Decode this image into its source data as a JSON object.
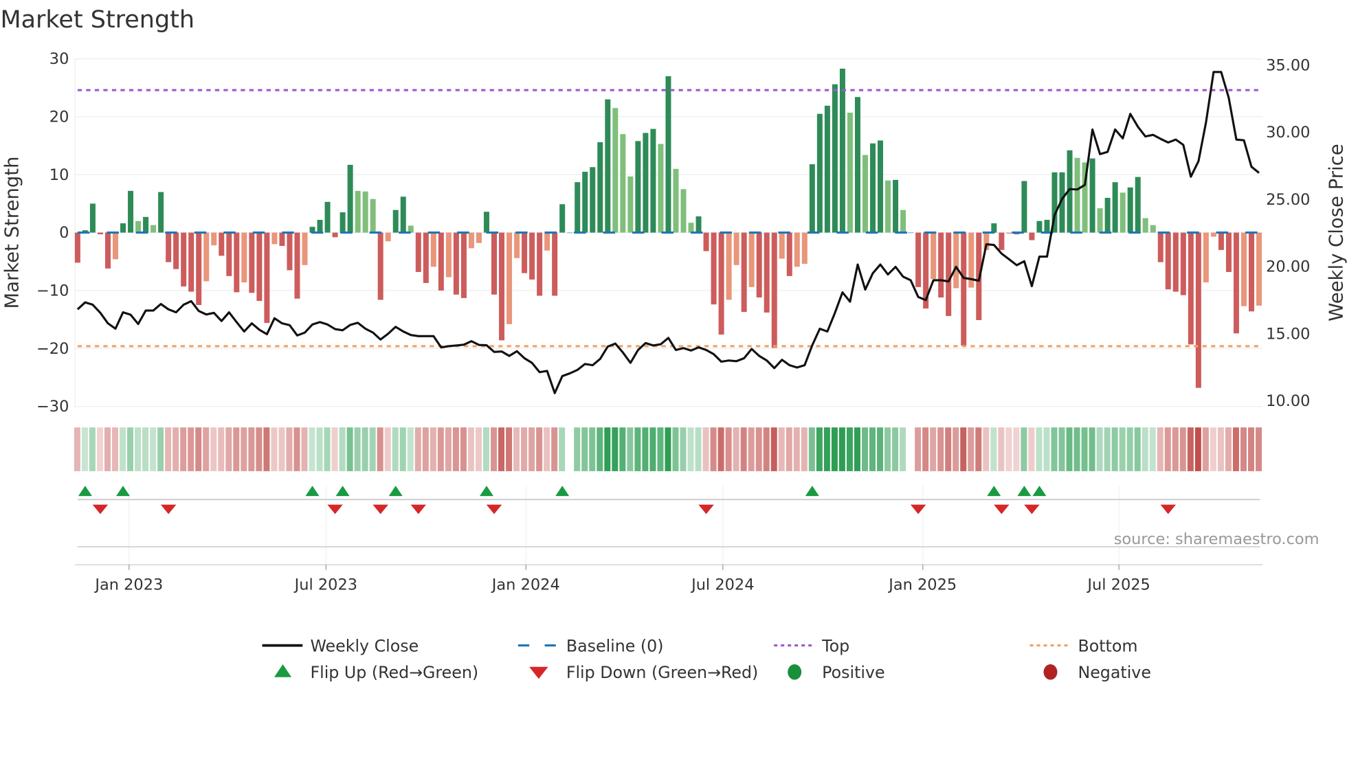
{
  "chart_data": {
    "type": "bar",
    "title": "Market Strength",
    "ylabel": "Market Strength",
    "y2label": "Weekly Close Price",
    "ylim": [
      -30,
      30
    ],
    "y2lim": [
      10,
      35
    ],
    "yticks": [
      "30",
      "20",
      "10",
      "0",
      "−10",
      "−20",
      "−30"
    ],
    "ytick_values": [
      30,
      20,
      10,
      0,
      -10,
      -20,
      -30
    ],
    "y2ticks": [
      "35.00",
      "30.00",
      "25.00",
      "20.00",
      "15.00",
      "10.00"
    ],
    "y2tick_values": [
      35,
      30,
      25,
      20,
      15,
      10
    ],
    "xticks": [
      {
        "label": "Jan 2023",
        "week": 6.8
      },
      {
        "label": "Jul 2023",
        "week": 32.8
      },
      {
        "label": "Jan 2024",
        "week": 59.2
      },
      {
        "label": "Jul 2024",
        "week": 85.2
      },
      {
        "label": "Jan 2025",
        "week": 111.6
      },
      {
        "label": "Jul 2025",
        "week": 137.5
      }
    ],
    "top_level": 24.6,
    "bottom_level": -19.6,
    "baseline": 0,
    "strength": [
      -5.2,
      0.4,
      5,
      -0.3,
      -6.2,
      -4.6,
      1.6,
      7.2,
      2,
      2.7,
      1.3,
      7,
      -5.1,
      -6.3,
      -9.3,
      -10.2,
      -12.5,
      -8.4,
      -2.2,
      -4,
      -7.5,
      -10.3,
      -8.6,
      -10.4,
      -11.8,
      -15.6,
      -2,
      -2.3,
      -6.5,
      -11.4,
      -5.6,
      1,
      2.2,
      5.3,
      -0.8,
      3.5,
      11.7,
      7.2,
      7.1,
      5.8,
      -11.6,
      -1.5,
      3.9,
      6.2,
      1.2,
      -6.8,
      -8.7,
      -5.9,
      -10,
      -7.7,
      -10.7,
      -11.3,
      -2.7,
      -1.8,
      3.6,
      -10.7,
      -18.6,
      -15.8,
      -4.4,
      -7,
      -8.1,
      -10.9,
      -3.1,
      -10.9,
      4.9,
      0,
      8.7,
      10.5,
      11.3,
      15.6,
      23,
      21.5,
      17,
      9.7,
      15.8,
      17.2,
      17.9,
      15.3,
      27,
      11,
      7.5,
      1.7,
      2.8,
      -3.2,
      -12.4,
      -17.6,
      -11.6,
      -5.6,
      -13.7,
      -9.4,
      -11.2,
      -13.8,
      -19.9,
      -4.5,
      -7.5,
      -5.9,
      -5.4,
      11.8,
      20.5,
      21.9,
      25.6,
      28.3,
      20.7,
      23.4,
      13.4,
      15.4,
      15.9,
      9,
      9.1,
      3.9,
      0,
      -9.4,
      -13.1,
      -8,
      -11.2,
      -14.4,
      -9.6,
      -19.5,
      -9.5,
      -15.1,
      -3,
      1.6,
      -3,
      -0.2,
      -0.3,
      8.9,
      -1.3,
      2,
      2.2,
      10.4,
      10.4,
      14.2,
      12.9,
      12.1,
      12.8,
      4.2,
      6,
      8.7,
      6.9,
      7.8,
      9.6,
      2.5,
      1.3,
      -5.1,
      -9.8,
      -10.2,
      -10.8,
      -19.3,
      -26.8,
      -8.6,
      -0.7,
      -3,
      -6.8,
      -17.4,
      -12.7,
      -13.6,
      -12.6
    ],
    "weekly_close": [
      16.75,
      17.27,
      17.1,
      16.49,
      15.71,
      15.31,
      16.53,
      16.35,
      15.66,
      16.66,
      16.66,
      17.15,
      16.75,
      16.53,
      17.1,
      17.36,
      16.63,
      16.37,
      16.49,
      15.88,
      16.53,
      15.8,
      15.1,
      15.71,
      15.23,
      14.9,
      16.09,
      15.71,
      15.57,
      14.81,
      15.02,
      15.62,
      15.8,
      15.62,
      15.28,
      15.19,
      15.59,
      15.75,
      15.31,
      15.02,
      14.5,
      14.93,
      15.45,
      15.1,
      14.84,
      14.76,
      14.76,
      14.76,
      13.92,
      14.01,
      14.06,
      14.12,
      14.38,
      14.1,
      14.08,
      13.58,
      13.61,
      13.28,
      13.63,
      13.11,
      12.76,
      12.07,
      12.16,
      10.51,
      11.78,
      11.98,
      12.24,
      12.68,
      12.59,
      13.06,
      13.98,
      14.2,
      13.54,
      12.76,
      13.72,
      14.24,
      14.06,
      14.15,
      14.62,
      13.72,
      13.86,
      13.68,
      13.92,
      13.72,
      13.41,
      12.85,
      12.94,
      12.89,
      13.11,
      13.8,
      13.28,
      12.94,
      12.37,
      12.99,
      12.59,
      12.42,
      12.59,
      14.06,
      15.31,
      15.1,
      16.49,
      18.02,
      17.32,
      20.09,
      18.22,
      19.44,
      20.09,
      19.35,
      19.92,
      19.18,
      18.92,
      17.67,
      17.44,
      18.92,
      18.92,
      18.83,
      19.92,
      19.09,
      19.0,
      18.88,
      21.6,
      21.55,
      20.91,
      20.48,
      20.04,
      20.34,
      18.48,
      20.68,
      20.68,
      23.77,
      24.98,
      25.71,
      25.68,
      26.02,
      30.15,
      28.31,
      28.48,
      30.15,
      29.49,
      31.31,
      30.36,
      29.63,
      29.75,
      29.45,
      29.18,
      29.4,
      29.0,
      26.63,
      27.79,
      30.7,
      34.43,
      34.43,
      32.52,
      29.4,
      29.35,
      27.37,
      26.92
    ],
    "flip_up_weeks": [
      1,
      6,
      31,
      35,
      42,
      54,
      64,
      97,
      121,
      125,
      127
    ],
    "flip_down_weeks": [
      3,
      12,
      34,
      40,
      45,
      55,
      83,
      111,
      122,
      126,
      144
    ],
    "legend": {
      "position": "bottom",
      "items": [
        {
          "label": "Weekly Close",
          "kind": "line",
          "color": "#111111"
        },
        {
          "label": "Baseline (0)",
          "kind": "dash",
          "color": "#1f77b4"
        },
        {
          "label": "Top",
          "kind": "dot",
          "color": "#9b59d6"
        },
        {
          "label": "Bottom",
          "kind": "dot",
          "color": "#f0a060"
        },
        {
          "label": "Flip Up (Red→Green)",
          "kind": "tri-up",
          "color": "#1a9a41"
        },
        {
          "label": "Flip Down (Green→Red)",
          "kind": "tri-down",
          "color": "#d62728"
        },
        {
          "label": "Positive",
          "kind": "circle",
          "color": "#1a8f3a"
        },
        {
          "label": "Negative",
          "kind": "circle",
          "color": "#b22222"
        }
      ]
    },
    "colors": {
      "pos_strong": "#2e8b57",
      "pos_weak": "#7fbf7b",
      "neg_strong": "#cd5c5c",
      "neg_weak": "#e9967a",
      "top": "#9b59d6",
      "bottom": "#f0a060",
      "baseline": "#1f77b4",
      "price": "#111111"
    }
  },
  "source": "source: sharemaestro.com"
}
